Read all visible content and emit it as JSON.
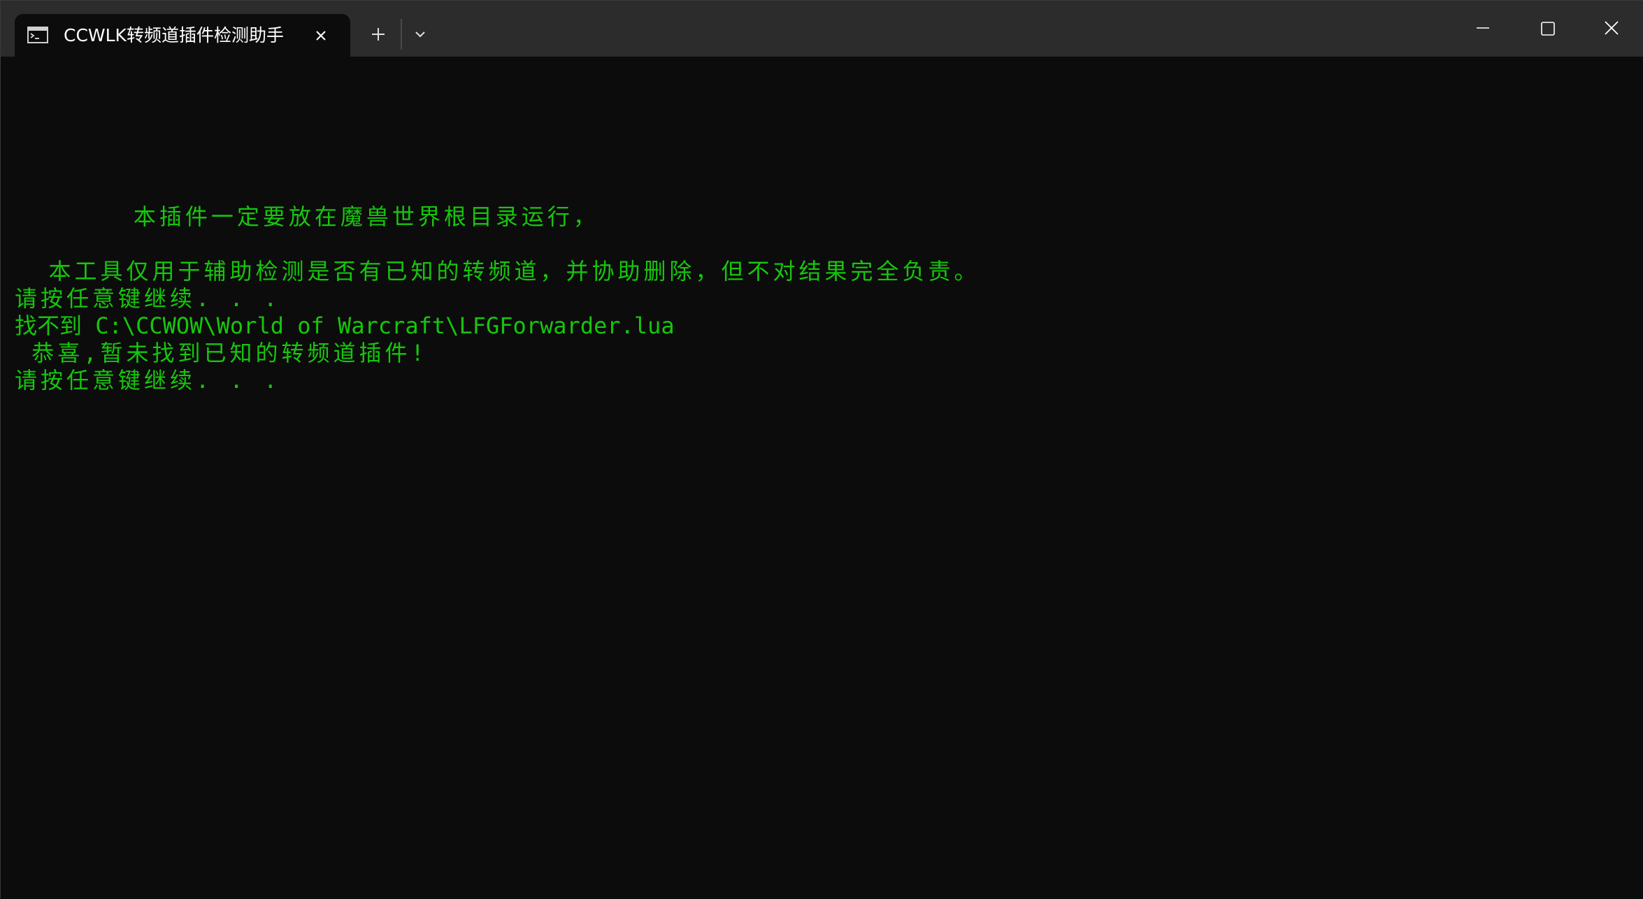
{
  "window": {
    "tab_title": "CCWLK转频道插件检测助手",
    "icons": {
      "tab": "console-icon",
      "close_tab": "close-icon",
      "new_tab": "plus-icon",
      "dropdown": "chevron-down-icon",
      "minimize": "minimize-icon",
      "maximize": "maximize-icon",
      "close": "close-icon"
    }
  },
  "terminal": {
    "text_color": "#16c60c",
    "background": "#0c0c0c",
    "lines": [
      "       本插件一定要放在魔兽世界根目录运行，",
      "  本工具仅用于辅助检测是否有已知的转频道，并协助删除，但不对结果完全负责。",
      "请按任意键继续. . .",
      "找不到 C:\\CCWOW\\World of Warcraft\\LFGForwarder.lua",
      " 恭喜,暂未找到已知的转频道插件!",
      "请按任意键继续. . ."
    ]
  }
}
